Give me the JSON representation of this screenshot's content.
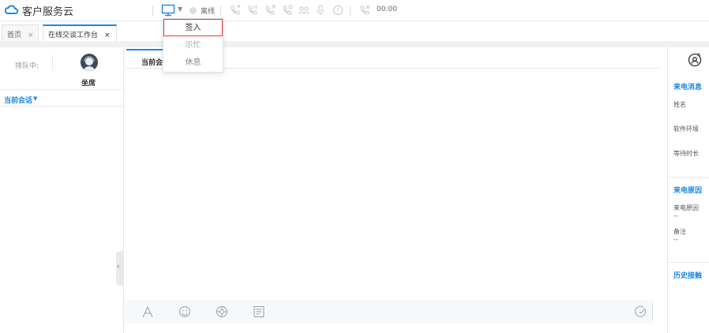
{
  "app": {
    "title": "客户服务云",
    "brand_color": "#1e88e5"
  },
  "toolbar": {
    "status_text": "离线",
    "timer": "00:00",
    "icons": [
      "monitor-icon",
      "phone-transfer-icon",
      "phone-hold-icon",
      "phone-consult-icon",
      "phone-conference-icon",
      "three-way-icon",
      "mic-icon",
      "info-icon",
      "phone-hangup-icon"
    ]
  },
  "tabs": [
    {
      "label": "首页",
      "close": "×"
    },
    {
      "label": "在线交谈工作台",
      "close": "×"
    }
  ],
  "status_menu": {
    "items": [
      "签入",
      "示忙",
      "休息"
    ],
    "highlighted": "签入"
  },
  "left_panel": {
    "queue_label": "排队中:",
    "agent_label": "坐席",
    "current_conversation": "当前会话",
    "collapse_arrow": "‹"
  },
  "center": {
    "tab_label": "当前会话",
    "toolbar_icons": [
      "font-icon",
      "emoji-icon",
      "screenshot-icon",
      "quick-reply-icon",
      "end-chat-icon"
    ]
  },
  "right_panel": {
    "incoming_message_title": "来电消息",
    "name_label": "姓名",
    "software_env_label": "软件环境",
    "wait_time_label": "等待时长",
    "call_reason_title": "来电原因",
    "call_reason_label": "来电原因",
    "call_reason_value": "--",
    "remark_label": "备注",
    "remark_value": "--",
    "history_title": "历史接触"
  }
}
